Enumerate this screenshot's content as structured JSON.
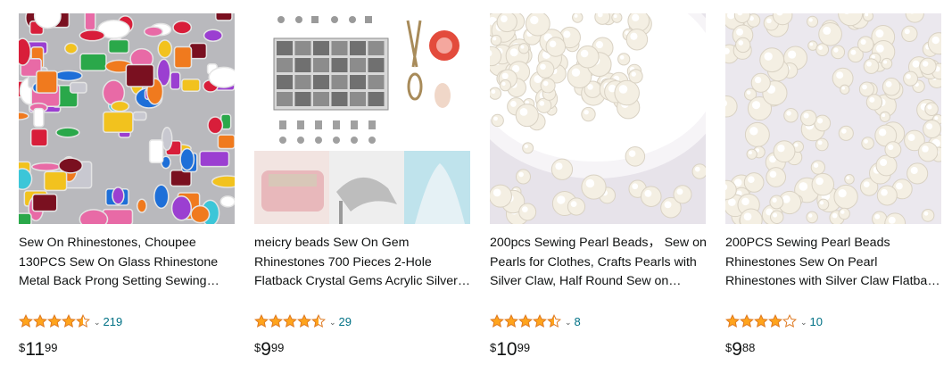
{
  "products": [
    {
      "title": "Sew On Rhinestones, Choupee 130PCS Sew On Glass Rhinestone Metal Back Prong Setting Sewing Claw Rhinestone Mixed Shapes fo...",
      "rating": 4.5,
      "review_count": "219",
      "price": {
        "symbol": "$",
        "whole": "11",
        "fraction": "99"
      },
      "image_icon": "rhinestones-image"
    },
    {
      "title": "meicry beads Sew On Gem Rhinestones 700 Pieces 2-Hole Flatback Crystal Gems Acrylic Silver with Needles Hand Stitchin...",
      "rating": 4.5,
      "review_count": "29",
      "price": {
        "symbol": "$",
        "whole": "9",
        "fraction": "99"
      },
      "image_icon": "gem-kit-image"
    },
    {
      "title": "200pcs Sewing Pearl Beads， Sew on Pearls for Clothes, Crafts Pearls with Silver Claw, Half Round Sew on Beads White Pearls (Silver Cla...",
      "rating": 4.5,
      "review_count": "8",
      "price": {
        "symbol": "$",
        "whole": "10",
        "fraction": "99"
      },
      "image_icon": "pearls-bowl-image"
    },
    {
      "title": "200PCS Sewing Pearl Beads Rhinestones Sew On Pearl Rhinestones with Silver Claw Flatback Half Round Pearl for Cra...",
      "rating": 4,
      "review_count": "10",
      "price": {
        "symbol": "$",
        "whole": "9",
        "fraction": "88"
      },
      "image_icon": "pearls-image"
    }
  ],
  "colors": {
    "star": "#ffa41c",
    "star_outline": "#de7921",
    "link": "#007185",
    "text": "#0f1111"
  }
}
